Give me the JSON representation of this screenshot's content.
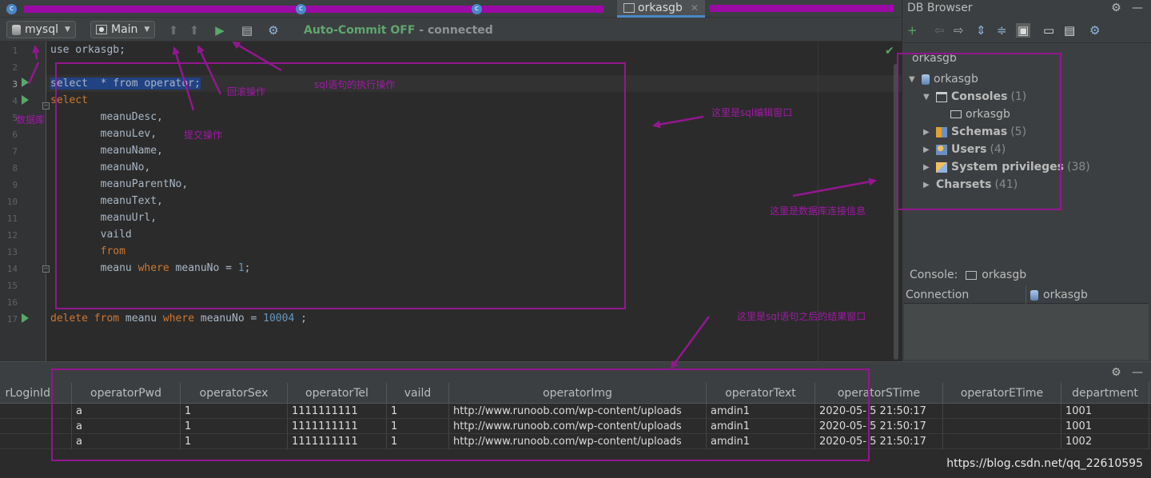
{
  "tabs": {
    "active_label": "orkasgb",
    "c_letter": "c"
  },
  "toolbar": {
    "connection": "mysql",
    "schema": "Main",
    "autocommit": "Auto-Commit OFF",
    "status": " - connected"
  },
  "editor": {
    "lines": [
      {
        "n": "1",
        "html": [
          {
            "t": "use orkasgb;",
            "c": "plain"
          }
        ]
      },
      {
        "n": "2",
        "html": []
      },
      {
        "n": "3",
        "html": [
          {
            "t": "select  * from operator;",
            "c": "sel"
          }
        ]
      },
      {
        "n": "4",
        "html": [
          {
            "t": "select",
            "c": "kw"
          }
        ]
      },
      {
        "n": "5",
        "html": [
          {
            "t": "        meanuDesc,",
            "c": "plain"
          }
        ]
      },
      {
        "n": "6",
        "html": [
          {
            "t": "        meanuLev,",
            "c": "plain"
          }
        ]
      },
      {
        "n": "7",
        "html": [
          {
            "t": "        meanuName,",
            "c": "plain"
          }
        ]
      },
      {
        "n": "8",
        "html": [
          {
            "t": "        meanuNo,",
            "c": "plain"
          }
        ]
      },
      {
        "n": "9",
        "html": [
          {
            "t": "        meanuParentNo,",
            "c": "plain"
          }
        ]
      },
      {
        "n": "10",
        "html": [
          {
            "t": "        meanuText,",
            "c": "plain"
          }
        ]
      },
      {
        "n": "11",
        "html": [
          {
            "t": "        meanuUrl,",
            "c": "plain"
          }
        ]
      },
      {
        "n": "12",
        "html": [
          {
            "t": "        vaild",
            "c": "plain"
          }
        ]
      },
      {
        "n": "13",
        "html": [
          {
            "t": "        ",
            "c": "plain"
          },
          {
            "t": "from",
            "c": "kw"
          }
        ]
      },
      {
        "n": "14",
        "html": [
          {
            "t": "        meanu ",
            "c": "plain"
          },
          {
            "t": "where",
            "c": "kw"
          },
          {
            "t": " meanuNo = ",
            "c": "plain"
          },
          {
            "t": "1",
            "c": "num"
          },
          {
            "t": ";",
            "c": "plain"
          }
        ]
      },
      {
        "n": "15",
        "html": []
      },
      {
        "n": "16",
        "html": []
      },
      {
        "n": "17",
        "html": [
          {
            "t": "delete ",
            "c": "kw"
          },
          {
            "t": "from",
            "c": "kw"
          },
          {
            "t": " meanu ",
            "c": "plain"
          },
          {
            "t": "where",
            "c": "kw"
          },
          {
            "t": " meanuNo = ",
            "c": "plain"
          },
          {
            "t": "10004",
            "c": "num"
          },
          {
            "t": " ;",
            "c": "plain"
          }
        ]
      }
    ]
  },
  "db_browser": {
    "title": "DB Browser",
    "root_label": "orkasgb",
    "tree": [
      {
        "label": "orkasgb",
        "count": "",
        "bold": false
      },
      {
        "label": "Consoles",
        "count": "(1)",
        "bold": true
      },
      {
        "label": "orkasgb",
        "count": "",
        "bold": false
      },
      {
        "label": "Schemas",
        "count": "(5)",
        "bold": true
      },
      {
        "label": "Users",
        "count": "(4)",
        "bold": true
      },
      {
        "label": "System privileges",
        "count": "(38)",
        "bold": true
      },
      {
        "label": "Charsets",
        "count": "(41)",
        "bold": true
      }
    ],
    "console_label": "Console:",
    "console_name": "orkasgb",
    "conn_header": "Connection",
    "conn_value": "orkasgb"
  },
  "results": {
    "columns": [
      "rLoginId",
      "operatorPwd",
      "operatorSex",
      "operatorTel",
      "vaild",
      "operatorImg",
      "operatorText",
      "operatorSTime",
      "operatorETime",
      "department"
    ],
    "rows": [
      [
        "",
        "a",
        "1",
        "1111111111",
        "1",
        "http://www.runoob.com/wp-content/uploads",
        "amdin1",
        "2020-05- 5 21:50:17",
        "",
        "1001"
      ],
      [
        "",
        "a",
        "1",
        "1111111111",
        "1",
        "http://www.runoob.com/wp-content/uploads",
        "amdin1",
        "2020-05- 5 21:50:17",
        "",
        "1001"
      ],
      [
        "",
        "a",
        "1",
        "1111111111",
        "1",
        "http://www.runoob.com/wp-content/uploads",
        "amdin1",
        "2020-05- 5 21:50:17",
        "",
        "1002"
      ]
    ]
  },
  "annotations": {
    "rollback": "回滚操作",
    "execute": "sql语句的执行操作",
    "commit": "提交操作",
    "db": "数据库",
    "editor_window": "这里是sql编辑窗口",
    "conn_info": "这里是数据库连接信息",
    "result_window": "这里是sql语句之后的结果窗口"
  },
  "watermark": "https://blog.csdn.net/qq_22610595",
  "colors": {
    "annotation": "#93178f",
    "keyword": "#cc7832",
    "number": "#6897bb",
    "run": "#59a869",
    "autocommit": "#5fa66f"
  }
}
